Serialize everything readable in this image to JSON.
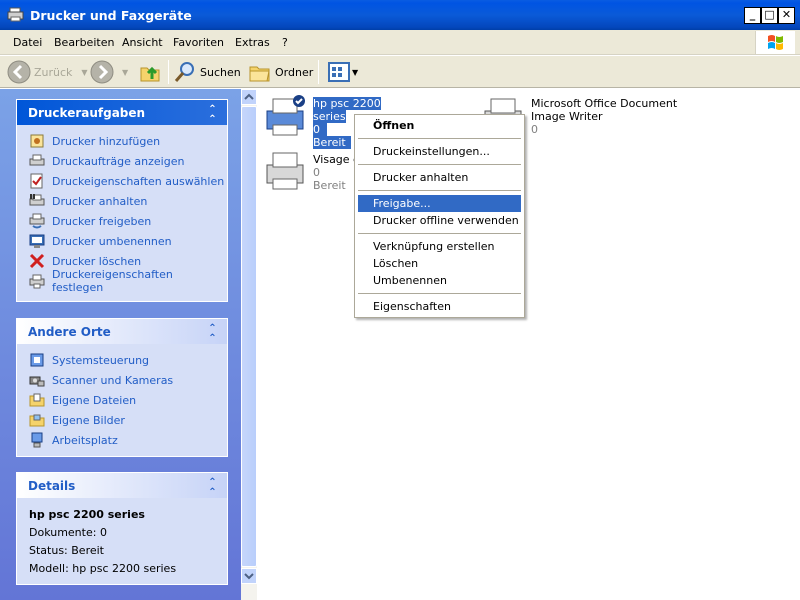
{
  "window": {
    "title": "Drucker und Faxgeräte"
  },
  "menubar": [
    "Datei",
    "Bearbeiten",
    "Ansicht",
    "Favoriten",
    "Extras",
    "?"
  ],
  "toolbar": {
    "back": "Zurück",
    "search": "Suchen",
    "folders": "Ordner"
  },
  "tasks": {
    "title": "Druckeraufgaben",
    "items": [
      "Drucker hinzufügen",
      "Druckaufträge anzeigen",
      "Druckeigenschaften auswählen",
      "Drucker anhalten",
      "Drucker freigeben",
      "Drucker umbenennen",
      "Drucker löschen",
      "Druckereigenschaften festlegen"
    ]
  },
  "places": {
    "title": "Andere Orte",
    "items": [
      "Systemsteuerung",
      "Scanner und Kameras",
      "Eigene Dateien",
      "Eigene Bilder",
      "Arbeitsplatz"
    ]
  },
  "details": {
    "title": "Details",
    "name": "hp psc 2200 series",
    "docs": "Dokumente: 0",
    "status": "Status: Bereit",
    "model": "Modell: hp psc 2200 series"
  },
  "printers": [
    {
      "name": "hp psc 2200 series",
      "docs": "0",
      "status": "Bereit"
    },
    {
      "name": "Visage e",
      "docs": "0",
      "status": "Bereit"
    },
    {
      "name_line1": "Microsoft Office Document",
      "name_line2": "Image Writer",
      "docs": "0"
    }
  ],
  "context_menu": {
    "open": "Öffnen",
    "prefs": "Druckeinstellungen...",
    "pause": "Drucker anhalten",
    "share": "Freigabe...",
    "offline": "Drucker offline verwenden",
    "shortcut": "Verknüpfung erstellen",
    "delete": "Löschen",
    "rename": "Umbenennen",
    "props": "Eigenschaften"
  },
  "colors": {
    "title_bar": "#0054e3",
    "selection": "#316ac5",
    "task_link": "#215dc6",
    "pane_bg": "#6b88d8"
  }
}
